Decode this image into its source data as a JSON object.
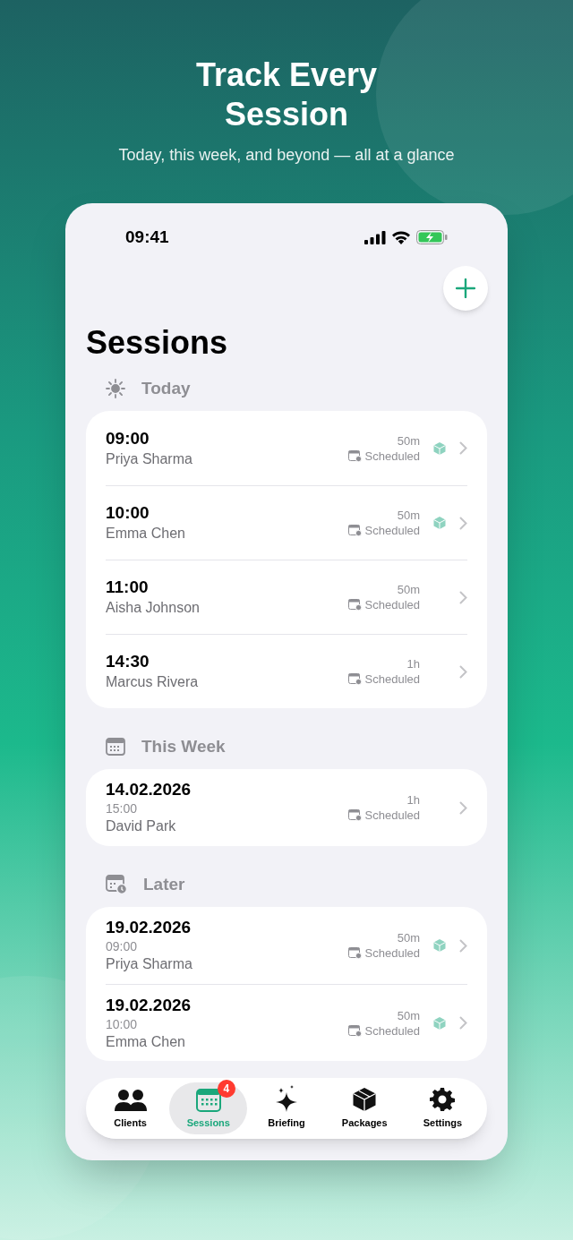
{
  "hero": {
    "title": "Track Every Session",
    "subtitle": "Today, this week, and beyond — all at a glance"
  },
  "status_bar": {
    "time": "09:41"
  },
  "title": "Sessions",
  "sections": [
    {
      "kind": "today",
      "label": "Today",
      "rows": [
        {
          "main": "09:00",
          "client": "Priya Sharma",
          "duration": "50m",
          "status": "Scheduled",
          "package": true
        },
        {
          "main": "10:00",
          "client": "Emma Chen",
          "duration": "50m",
          "status": "Scheduled",
          "package": true
        },
        {
          "main": "11:00",
          "client": "Aisha Johnson",
          "duration": "50m",
          "status": "Scheduled",
          "package": false
        },
        {
          "main": "14:30",
          "client": "Marcus Rivera",
          "duration": "1h",
          "status": "Scheduled",
          "package": false
        }
      ]
    },
    {
      "kind": "week",
      "label": "This Week",
      "rows": [
        {
          "main": "14.02.2026",
          "time": "15:00",
          "client": "David Park",
          "duration": "1h",
          "status": "Scheduled",
          "package": false
        }
      ]
    },
    {
      "kind": "later",
      "label": "Later",
      "rows": [
        {
          "main": "19.02.2026",
          "time": "09:00",
          "client": "Priya Sharma",
          "duration": "50m",
          "status": "Scheduled",
          "package": true
        },
        {
          "main": "19.02.2026",
          "time": "10:00",
          "client": "Emma Chen",
          "duration": "50m",
          "status": "Scheduled",
          "package": true
        }
      ]
    }
  ],
  "tabs": [
    {
      "kind": "clients",
      "label": "Clients",
      "selected": false
    },
    {
      "kind": "sessions",
      "label": "Sessions",
      "selected": true,
      "badge": "4"
    },
    {
      "kind": "briefing",
      "label": "Briefing",
      "selected": false
    },
    {
      "kind": "packages",
      "label": "Packages",
      "selected": false
    },
    {
      "kind": "settings",
      "label": "Settings",
      "selected": false
    }
  ]
}
